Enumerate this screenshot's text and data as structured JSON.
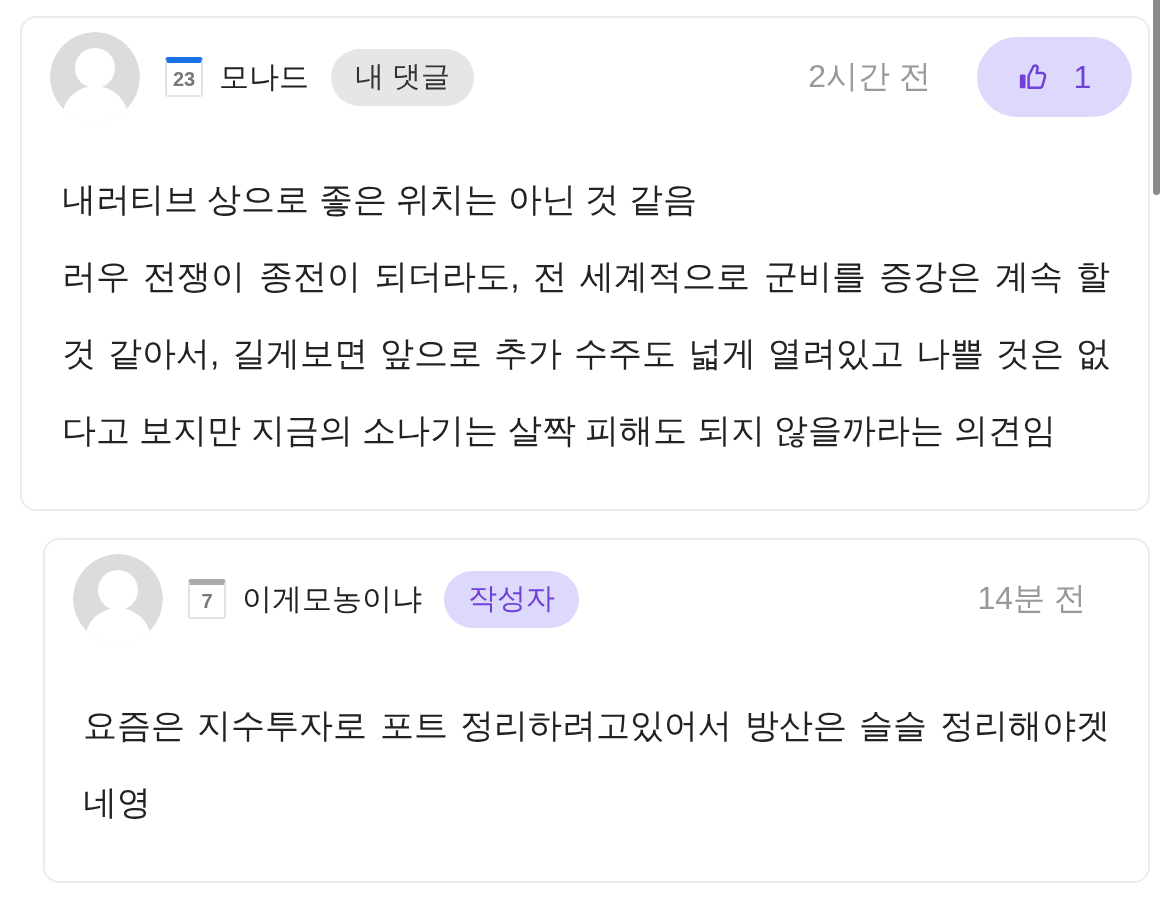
{
  "comments": [
    {
      "author": {
        "name": "모나드",
        "level_icon": {
          "number": "23",
          "color": "#1a73e8"
        }
      },
      "tag": {
        "kind": "mine",
        "label": "내 댓글"
      },
      "time": "2시간 전",
      "likes": {
        "count": "1"
      },
      "text": "내러티브 상으로 좋은 위치는 아닌 것 같음\n러우 전쟁이 종전이 되더라도, 전 세계적으로 군비를 증강은 계속 할 것 같아서, 길게보면 앞으로 추가 수주도 넓게 열려있고 나쁠 것은 없다고 보지만 지금의 소나기는 살짝 피해도 되지 않을까라는 의견임",
      "replies": [
        {
          "author": {
            "name": "이게모농이냐",
            "level_icon": {
              "number": "7",
              "color": "#aaaaaa"
            }
          },
          "tag": {
            "kind": "author",
            "label": "작성자"
          },
          "time": "14분 전",
          "text": "요즘은 지수투자로 포트 정리하려고있어서 방산은 슬슬 정리해야겟네영"
        }
      ]
    }
  ]
}
